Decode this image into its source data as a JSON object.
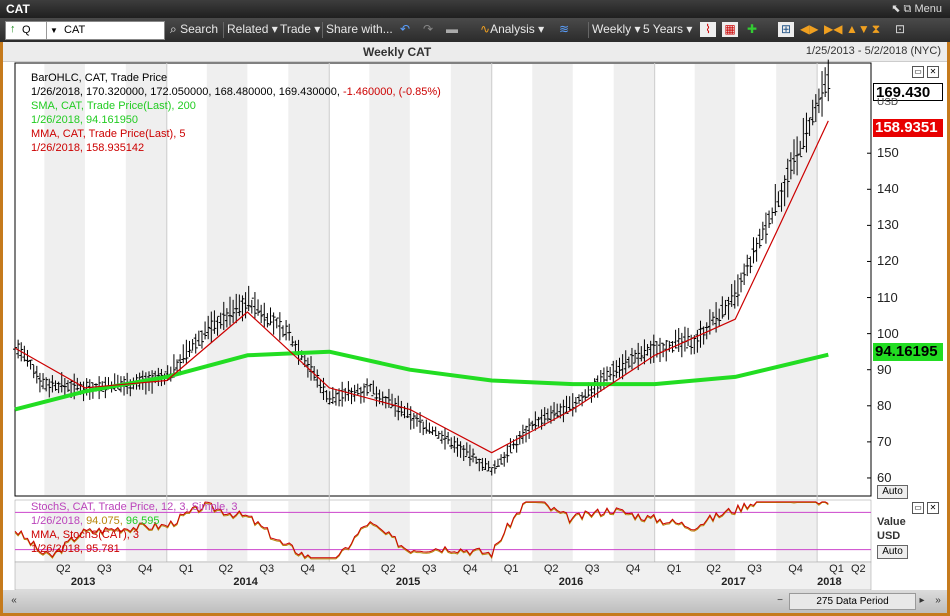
{
  "window": {
    "title": "CAT",
    "menu_label": "Menu"
  },
  "toolbar": {
    "symbol_value": "CAT",
    "symbol_prefix": "Q",
    "search": "Search",
    "related": "Related",
    "trade": "Trade",
    "share": "Share with...",
    "analysis": "Analysis",
    "periodicity": "Weekly",
    "range": "5 Years"
  },
  "header": {
    "chart_title": "Weekly CAT",
    "date_range": "1/25/2013 - 5/2/2018 (NYC)"
  },
  "legend": {
    "bar_title": "BarOHLC, CAT, Trade Price",
    "bar_values_prefix": "1/26/2018, 170.320000, 172.050000, 168.480000, 169.430000,",
    "bar_change": "-1.460000, (-0.85%)",
    "sma_title": "SMA, CAT, Trade Price(Last),  200",
    "sma_value": "1/26/2018, 94.161950",
    "mma_title": "MMA, CAT, Trade Price(Last),  5",
    "mma_value": "1/26/2018, 158.935142"
  },
  "price_boxes": {
    "last": "169.430",
    "mma": "158.9351",
    "sma": "94.16195",
    "currency": "USD"
  },
  "y_axis": {
    "ticks": [
      "60",
      "70",
      "80",
      "90",
      "100",
      "110",
      "120",
      "130",
      "140",
      "150"
    ],
    "auto": "Auto"
  },
  "stoch": {
    "title": "StochS, CAT, Trade Price,  12, 3, Simple,  3",
    "values_date": "1/26/2018,",
    "value_k": "94.075,",
    "value_d": "96.595",
    "mma_title": "MMA, StochS(CAT),  3",
    "mma_value": "1/26/2018, 95.781",
    "axis_label": "Value",
    "currency": "USD",
    "auto": "Auto"
  },
  "x_axis": {
    "quarters": [
      "Q2",
      "Q3",
      "Q4",
      "Q1",
      "Q2",
      "Q3",
      "Q4",
      "Q1",
      "Q2",
      "Q3",
      "Q4",
      "Q1",
      "Q2",
      "Q3",
      "Q4",
      "Q1",
      "Q2",
      "Q3",
      "Q4",
      "Q1",
      "Q2"
    ],
    "years": [
      "2013",
      "2014",
      "2015",
      "2016",
      "2017",
      "2018"
    ]
  },
  "status": {
    "data_period": "275 Data Period"
  },
  "colors": {
    "sma": "#22dd22",
    "mma": "#cc0000",
    "stoch_k": "#b8860b",
    "stoch_d": "#cc0000",
    "stoch_levels": "#cc44cc",
    "accent": "#c57a1c"
  },
  "chart_data": {
    "type": "line",
    "title": "Weekly CAT",
    "ylim": [
      55,
      175
    ],
    "x_range": [
      "2013-01-25",
      "2018-05-02"
    ],
    "series": [
      {
        "name": "CAT",
        "x": [
          "2013-01-25",
          "2013-04-01",
          "2013-07-01",
          "2013-10-01",
          "2014-01-01",
          "2014-04-01",
          "2014-07-01",
          "2014-10-01",
          "2015-01-01",
          "2015-04-01",
          "2015-07-01",
          "2015-10-01",
          "2016-01-01",
          "2016-04-01",
          "2016-07-01",
          "2016-10-01",
          "2017-01-01",
          "2017-04-01",
          "2017-07-01",
          "2017-10-01",
          "2018-01-26"
        ],
        "values": [
          97,
          86,
          85,
          86,
          88,
          101,
          109,
          100,
          82,
          85,
          77,
          70,
          62,
          75,
          80,
          90,
          96,
          98,
          110,
          136,
          169.43
        ]
      },
      {
        "name": "SMA, CAT, Trade Price(Last),  200",
        "x": [
          "2013-01-25",
          "2013-07-01",
          "2014-01-01",
          "2014-07-01",
          "2015-01-01",
          "2015-07-01",
          "2016-01-01",
          "2016-07-01",
          "2017-01-01",
          "2017-07-01",
          "2018-01-26"
        ],
        "values": [
          79,
          84,
          88,
          94,
          95,
          90,
          87,
          86,
          86,
          88,
          94.16
        ]
      },
      {
        "name": "MMA, CAT, Trade Price(Last),  5",
        "x": [
          "2013-01-25",
          "2013-07-01",
          "2014-01-01",
          "2014-07-01",
          "2015-01-01",
          "2015-07-01",
          "2016-01-01",
          "2016-07-01",
          "2017-01-01",
          "2017-07-01",
          "2017-10-01",
          "2018-01-26"
        ],
        "values": [
          96,
          85,
          87,
          106,
          85,
          79,
          67,
          79,
          94,
          104,
          128,
          158.94
        ]
      }
    ],
    "stoch": {
      "ylim": [
        0,
        100
      ],
      "levels": [
        80,
        20
      ],
      "series": [
        {
          "name": "StochS, CAT, Trade Price,  12, 3, Simple,  3",
          "last": 94.075
        },
        {
          "name": "MMA, StochS(CAT),  3",
          "last": 95.781
        }
      ]
    }
  }
}
